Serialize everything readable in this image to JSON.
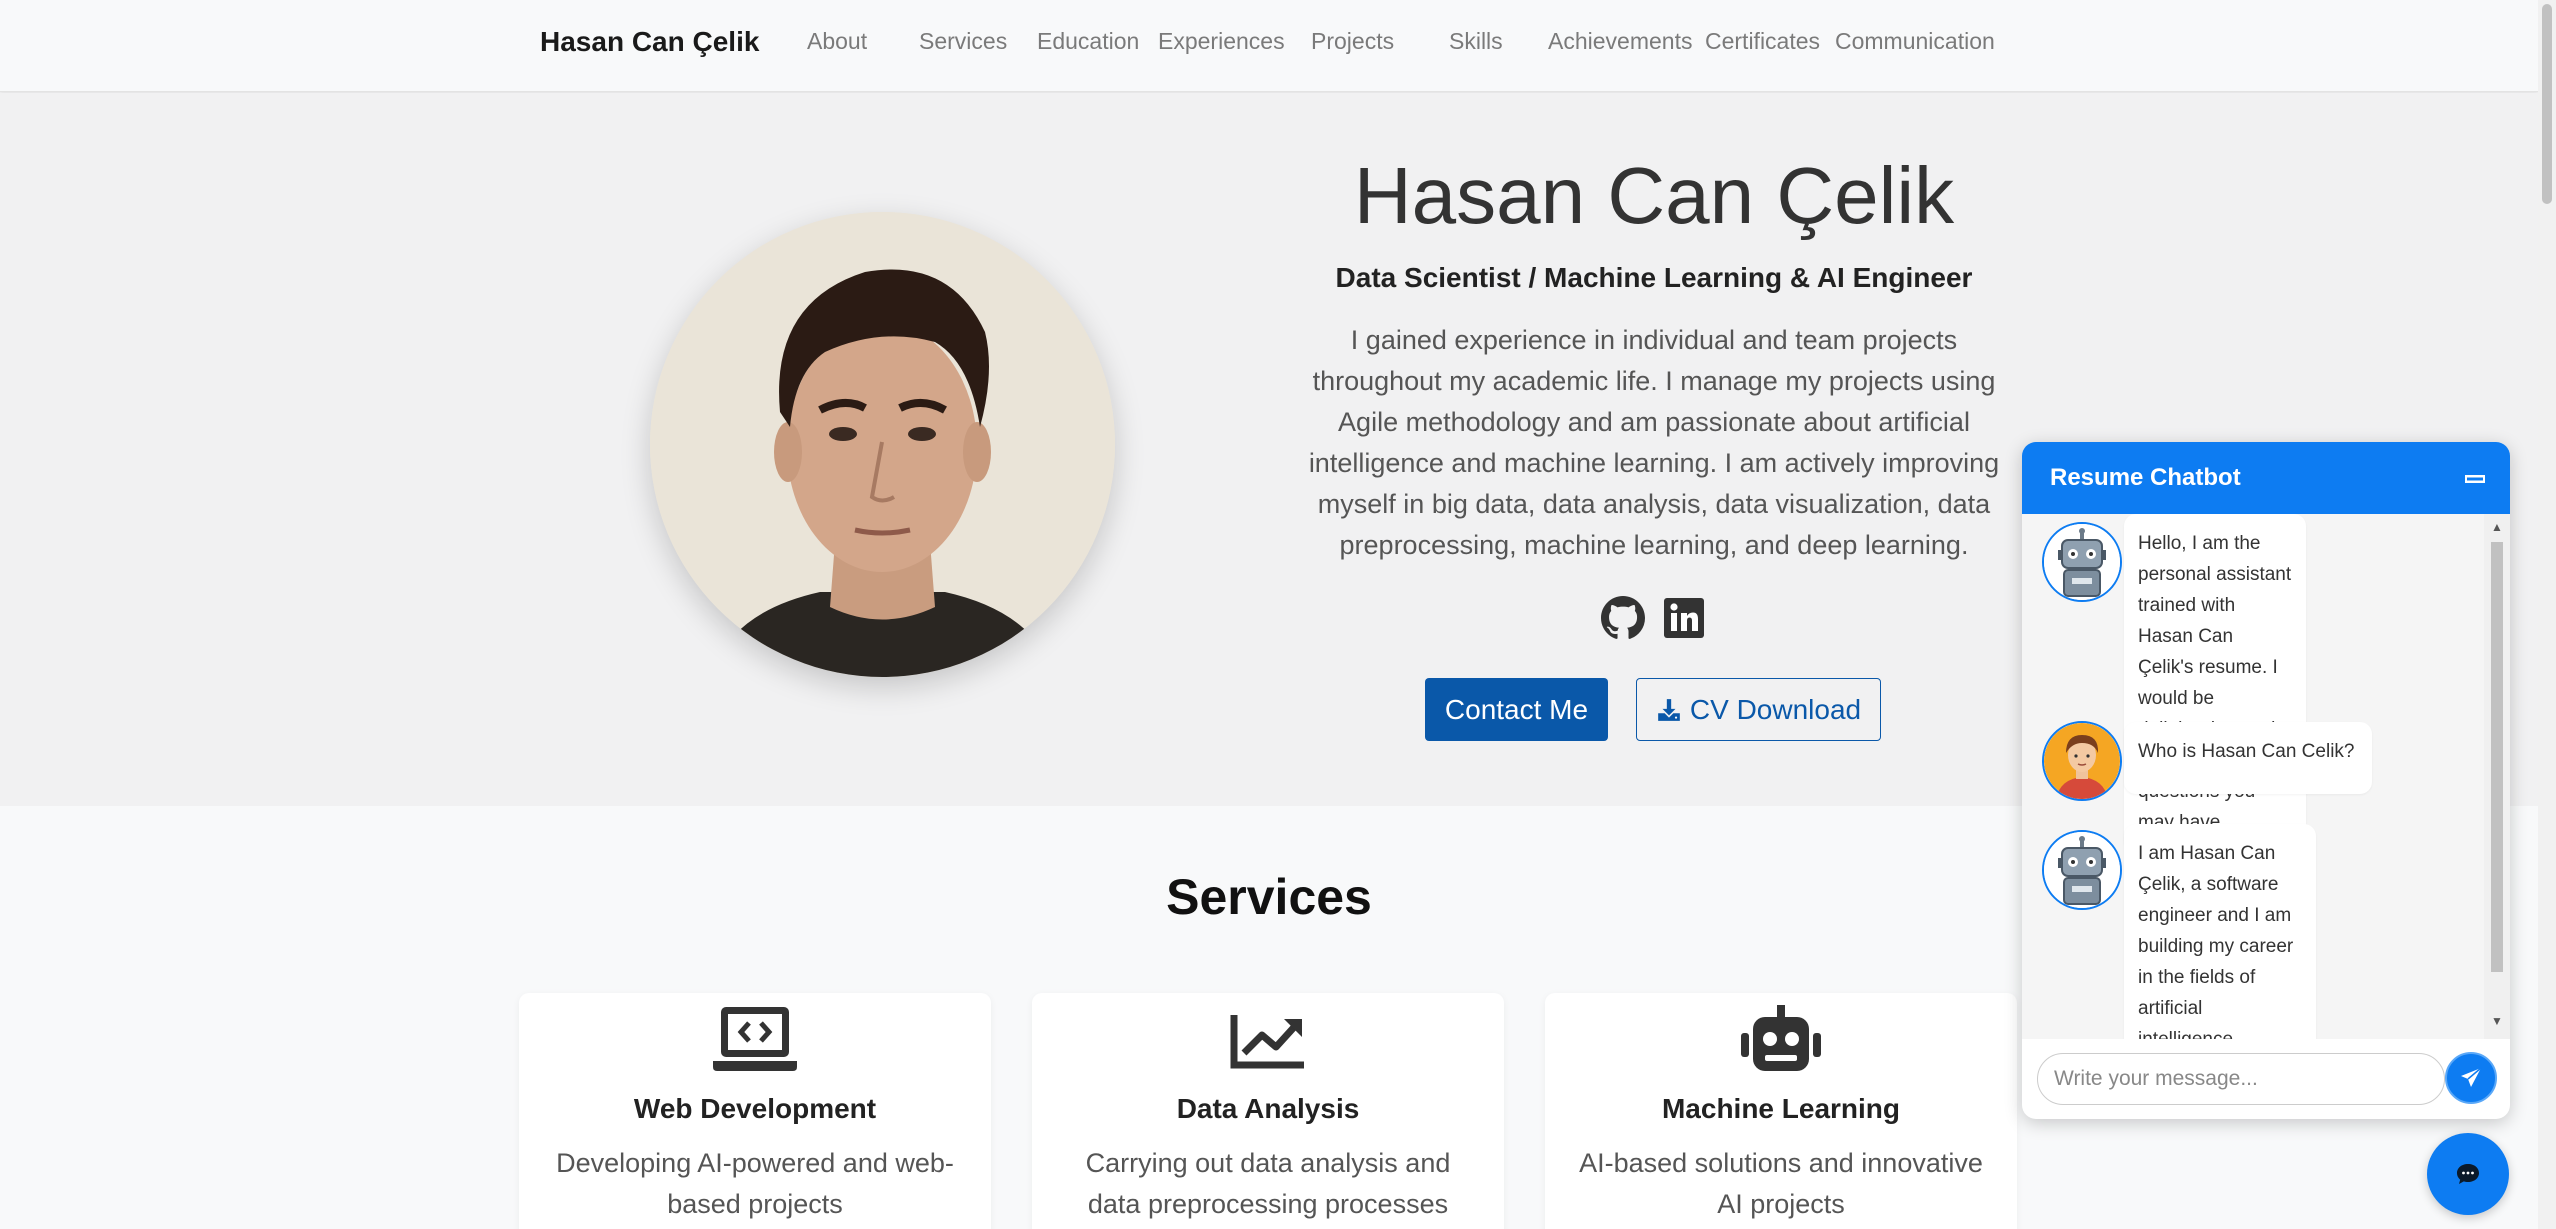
{
  "nav": {
    "brand": "Hasan Can Çelik",
    "links": [
      "About",
      "Services",
      "Education",
      "Experiences",
      "Projects",
      "Skills",
      "Achievements",
      "Certificates",
      "Communication"
    ]
  },
  "hero": {
    "name": "Hasan Can Çelik",
    "subtitle": "Data Scientist / Machine Learning & AI Engineer",
    "description": "I gained experience in individual and team projects throughout my academic life. I manage my projects using Agile methodology and am passionate about artificial intelligence and machine learning. I am actively improving myself in big data, data analysis, data visualization, data preprocessing, machine learning, and deep learning.",
    "contact_label": "Contact Me",
    "cv_label": "CV Download"
  },
  "services": {
    "title": "Services",
    "cards": [
      {
        "title": "Web Development",
        "desc": "Developing AI-powered and web-based projects",
        "icon": "laptop-code-icon"
      },
      {
        "title": "Data Analysis",
        "desc": "Carrying out data analysis and data preprocessing processes",
        "icon": "chart-line-icon"
      },
      {
        "title": "Machine Learning",
        "desc": "AI-based solutions and innovative AI projects",
        "icon": "robot-icon"
      }
    ]
  },
  "chatbot": {
    "title": "Resume Chatbot",
    "messages": [
      {
        "sender": "bot",
        "text": "Hello, I am the personal assistant trained with Hasan Can Çelik's resume. I would be delighted to assist you with any questions you may have."
      },
      {
        "sender": "user",
        "text": "Who is Hasan Can Celik?"
      },
      {
        "sender": "bot",
        "text": "I am Hasan Can Çelik, a software engineer and I am building my career in the fields of artificial intelligence, machine learning, big data and data science."
      }
    ],
    "input_placeholder": "Write your message...",
    "accent": "#0d7cf2"
  }
}
